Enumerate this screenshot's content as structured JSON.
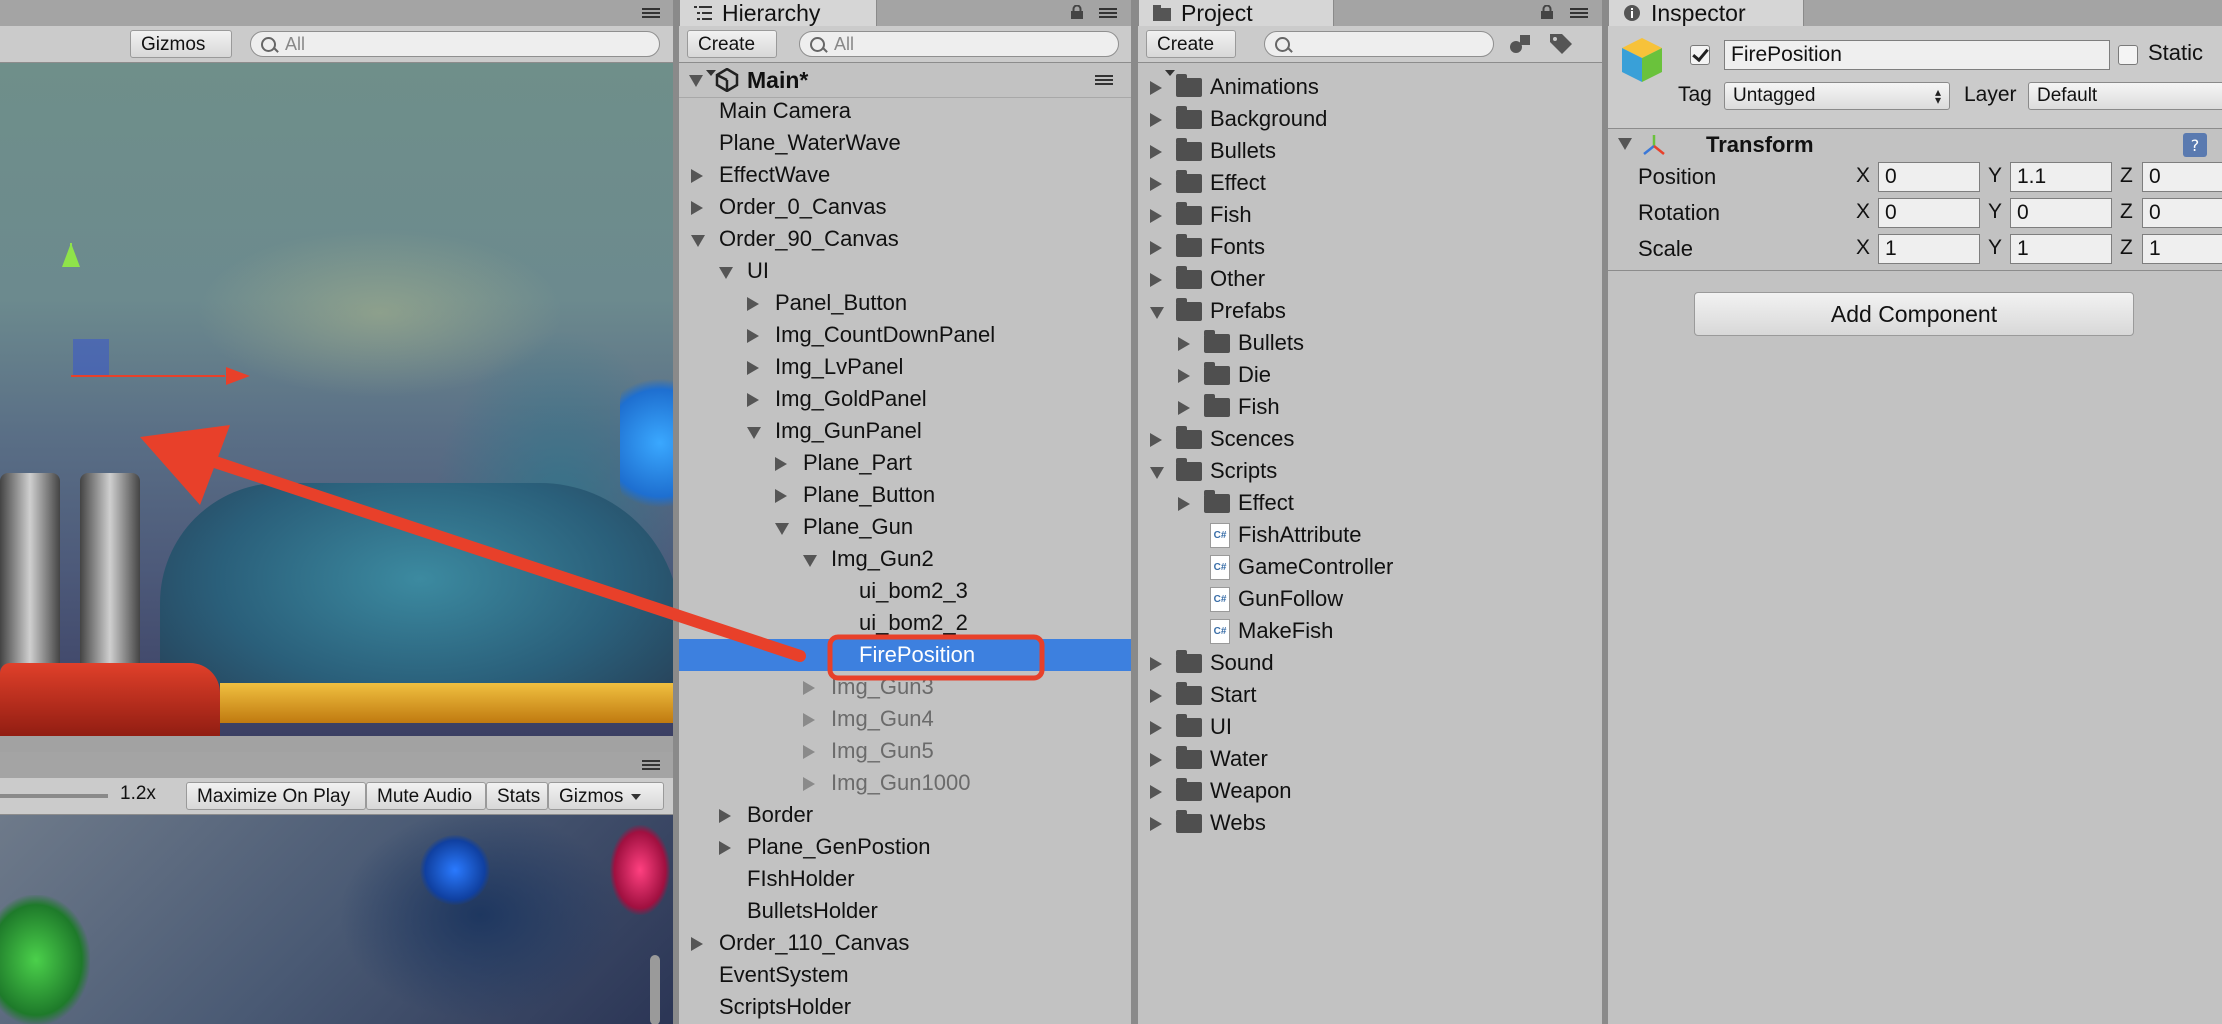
{
  "scene": {
    "toolbar": {
      "gizmos_label": "Gizmos",
      "search_placeholder": "All"
    }
  },
  "game": {
    "toolbar": {
      "scale_value": "1.2x",
      "maximize_label": "Maximize On Play",
      "mute_label": "Mute Audio",
      "stats_label": "Stats",
      "gizmos_label": "Gizmos"
    }
  },
  "hierarchy": {
    "tab_label": "Hierarchy",
    "create_label": "Create",
    "search_placeholder": "All",
    "scene_name": "Main*",
    "rows": [
      {
        "label": "Main Camera",
        "depth": 1,
        "arrow": "none",
        "state": "normal"
      },
      {
        "label": "Plane_WaterWave",
        "depth": 1,
        "arrow": "none",
        "state": "normal"
      },
      {
        "label": "EffectWave",
        "depth": 1,
        "arrow": "right",
        "state": "normal"
      },
      {
        "label": "Order_0_Canvas",
        "depth": 1,
        "arrow": "right",
        "state": "normal"
      },
      {
        "label": "Order_90_Canvas",
        "depth": 1,
        "arrow": "down",
        "state": "normal"
      },
      {
        "label": "UI",
        "depth": 2,
        "arrow": "down",
        "state": "normal"
      },
      {
        "label": "Panel_Button",
        "depth": 3,
        "arrow": "right",
        "state": "normal"
      },
      {
        "label": "Img_CountDownPanel",
        "depth": 3,
        "arrow": "right",
        "state": "normal"
      },
      {
        "label": "Img_LvPanel",
        "depth": 3,
        "arrow": "right",
        "state": "normal"
      },
      {
        "label": "Img_GoldPanel",
        "depth": 3,
        "arrow": "right",
        "state": "normal"
      },
      {
        "label": "Img_GunPanel",
        "depth": 3,
        "arrow": "down",
        "state": "normal"
      },
      {
        "label": "Plane_Part",
        "depth": 4,
        "arrow": "right",
        "state": "normal"
      },
      {
        "label": "Plane_Button",
        "depth": 4,
        "arrow": "right",
        "state": "normal"
      },
      {
        "label": "Plane_Gun",
        "depth": 4,
        "arrow": "down",
        "state": "normal"
      },
      {
        "label": "Img_Gun2",
        "depth": 5,
        "arrow": "down",
        "state": "normal"
      },
      {
        "label": "ui_bom2_3",
        "depth": 6,
        "arrow": "none",
        "state": "normal"
      },
      {
        "label": "ui_bom2_2",
        "depth": 6,
        "arrow": "none",
        "state": "normal"
      },
      {
        "label": "FirePosition",
        "depth": 6,
        "arrow": "none",
        "state": "selected"
      },
      {
        "label": "Img_Gun3",
        "depth": 5,
        "arrow": "right",
        "state": "dim"
      },
      {
        "label": "Img_Gun4",
        "depth": 5,
        "arrow": "right",
        "state": "dim"
      },
      {
        "label": "Img_Gun5",
        "depth": 5,
        "arrow": "right",
        "state": "dim"
      },
      {
        "label": "Img_Gun1000",
        "depth": 5,
        "arrow": "right",
        "state": "dim"
      },
      {
        "label": "Border",
        "depth": 2,
        "arrow": "right",
        "state": "normal"
      },
      {
        "label": "Plane_GenPostion",
        "depth": 2,
        "arrow": "right",
        "state": "normal"
      },
      {
        "label": "FIshHolder",
        "depth": 2,
        "arrow": "none",
        "state": "normal"
      },
      {
        "label": "BulletsHolder",
        "depth": 2,
        "arrow": "none",
        "state": "normal"
      },
      {
        "label": "Order_110_Canvas",
        "depth": 1,
        "arrow": "right",
        "state": "normal"
      },
      {
        "label": "EventSystem",
        "depth": 1,
        "arrow": "none",
        "state": "normal"
      },
      {
        "label": "ScriptsHolder",
        "depth": 1,
        "arrow": "none",
        "state": "normal"
      }
    ]
  },
  "project": {
    "tab_label": "Project",
    "create_label": "Create",
    "rows": [
      {
        "label": "Animations",
        "depth": 0,
        "arrow": "right",
        "icon": "folder"
      },
      {
        "label": "Background",
        "depth": 0,
        "arrow": "right",
        "icon": "folder"
      },
      {
        "label": "Bullets",
        "depth": 0,
        "arrow": "right",
        "icon": "folder"
      },
      {
        "label": "Effect",
        "depth": 0,
        "arrow": "right",
        "icon": "folder"
      },
      {
        "label": "Fish",
        "depth": 0,
        "arrow": "right",
        "icon": "folder"
      },
      {
        "label": "Fonts",
        "depth": 0,
        "arrow": "right",
        "icon": "folder"
      },
      {
        "label": "Other",
        "depth": 0,
        "arrow": "right",
        "icon": "folder"
      },
      {
        "label": "Prefabs",
        "depth": 0,
        "arrow": "down",
        "icon": "folder"
      },
      {
        "label": "Bullets",
        "depth": 1,
        "arrow": "right",
        "icon": "folder"
      },
      {
        "label": "Die",
        "depth": 1,
        "arrow": "right",
        "icon": "folder"
      },
      {
        "label": "Fish",
        "depth": 1,
        "arrow": "right",
        "icon": "folder"
      },
      {
        "label": "Scences",
        "depth": 0,
        "arrow": "right",
        "icon": "folder"
      },
      {
        "label": "Scripts",
        "depth": 0,
        "arrow": "down",
        "icon": "folder"
      },
      {
        "label": "Effect",
        "depth": 1,
        "arrow": "right",
        "icon": "folder"
      },
      {
        "label": "FishAttribute",
        "depth": 1,
        "arrow": "none",
        "icon": "cs"
      },
      {
        "label": "GameController",
        "depth": 1,
        "arrow": "none",
        "icon": "cs"
      },
      {
        "label": "GunFollow",
        "depth": 1,
        "arrow": "none",
        "icon": "cs"
      },
      {
        "label": "MakeFish",
        "depth": 1,
        "arrow": "none",
        "icon": "cs"
      },
      {
        "label": "Sound",
        "depth": 0,
        "arrow": "right",
        "icon": "folder"
      },
      {
        "label": "Start",
        "depth": 0,
        "arrow": "right",
        "icon": "folder"
      },
      {
        "label": "UI",
        "depth": 0,
        "arrow": "right",
        "icon": "folder"
      },
      {
        "label": "Water",
        "depth": 0,
        "arrow": "right",
        "icon": "folder"
      },
      {
        "label": "Weapon",
        "depth": 0,
        "arrow": "right",
        "icon": "folder"
      },
      {
        "label": "Webs",
        "depth": 0,
        "arrow": "right",
        "icon": "folder"
      }
    ],
    "cs_glyph": "C#"
  },
  "inspector": {
    "tab_label": "Inspector",
    "object_name": "FirePosition",
    "active": true,
    "static_label": "Static",
    "tag_label": "Tag",
    "tag_value": "Untagged",
    "layer_label": "Layer",
    "layer_value": "Default",
    "transform_title": "Transform",
    "add_component_label": "Add Component",
    "transform_rows": [
      {
        "label": "Position",
        "x": "0",
        "y": "1.1",
        "z": "0"
      },
      {
        "label": "Rotation",
        "x": "0",
        "y": "0",
        "z": "0"
      },
      {
        "label": "Scale",
        "x": "1",
        "y": "1",
        "z": "1"
      }
    ],
    "axis_labels": {
      "x": "X",
      "y": "Y",
      "z": "Z"
    }
  },
  "colors": {
    "selection": "#3d80df",
    "annotation": "#e8402a"
  }
}
